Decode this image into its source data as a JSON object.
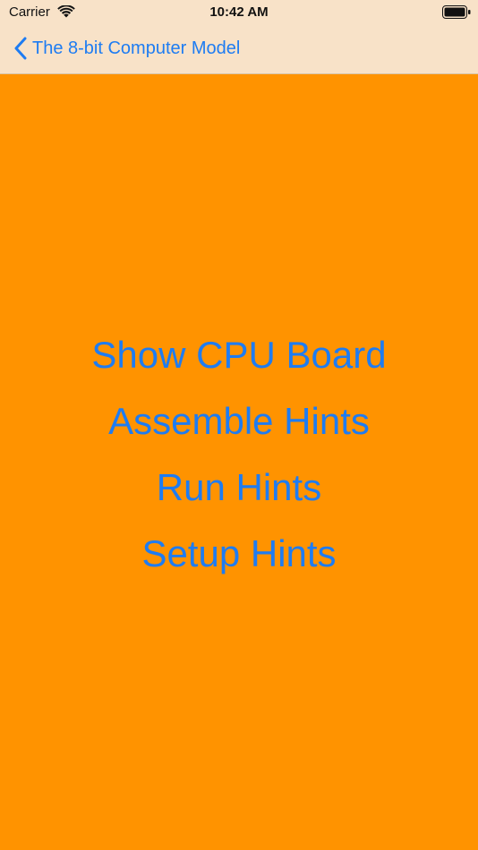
{
  "status_bar": {
    "carrier": "Carrier",
    "time": "10:42 AM",
    "wifi_icon": "wifi-icon",
    "battery_icon": "battery-icon"
  },
  "nav_bar": {
    "back_label": "The 8-bit Computer Model",
    "back_icon": "chevron-left-icon"
  },
  "menu": {
    "items": [
      {
        "label": "Show CPU Board"
      },
      {
        "label": "Assemble Hints"
      },
      {
        "label": "Run Hints"
      },
      {
        "label": "Setup Hints"
      }
    ]
  },
  "colors": {
    "background": "#FF9300",
    "nav_bar": "#F8E2C8",
    "accent": "#1E7CF2"
  }
}
